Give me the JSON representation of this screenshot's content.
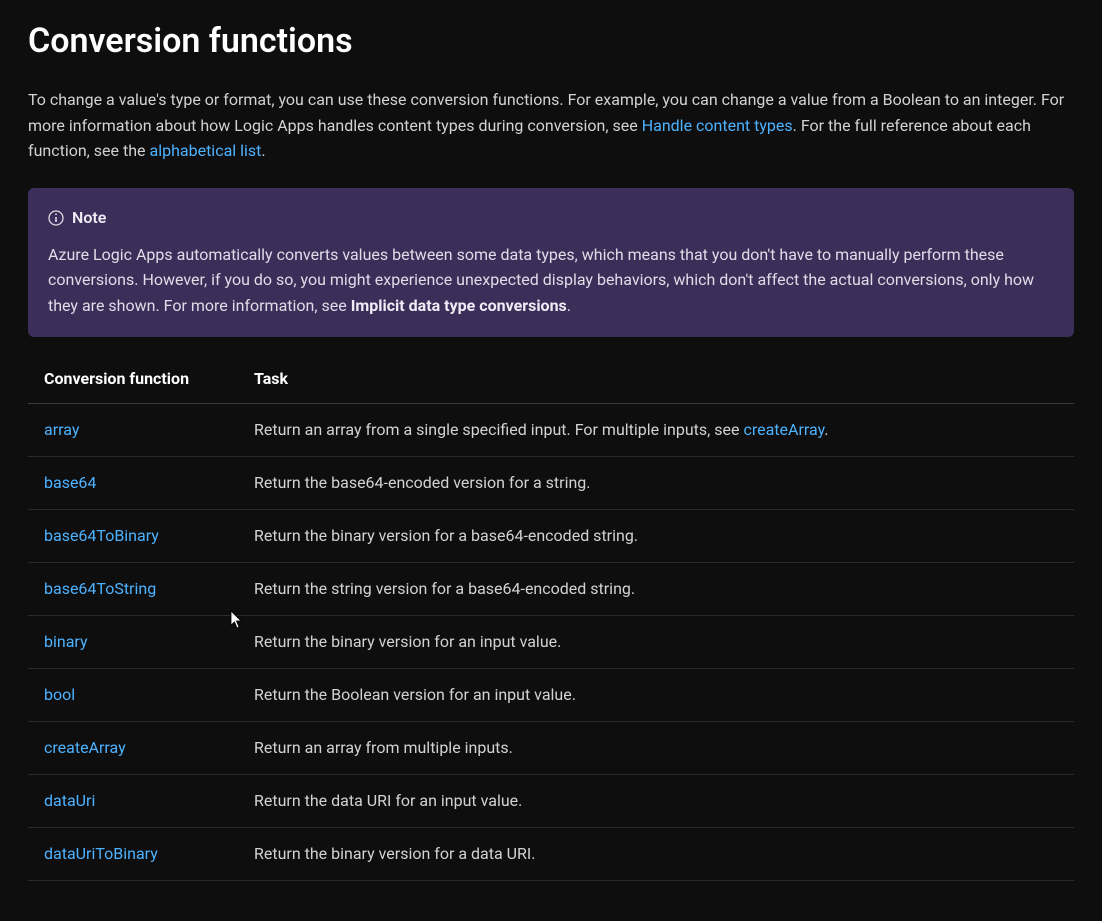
{
  "heading": "Conversion functions",
  "intro": {
    "text_before_link1": "To change a value's type or format, you can use these conversion functions. For example, you can change a value from a Boolean to an integer. For more information about how Logic Apps handles content types during conversion, see ",
    "link1": "Handle content types",
    "text_after_link1": ". For the full reference about each function, see the ",
    "link2": "alphabetical list",
    "text_after_link2": "."
  },
  "note": {
    "title": "Note",
    "body_before_strong": "Azure Logic Apps automatically converts values between some data types, which means that you don't have to manually perform these conversions. However, if you do so, you might experience unexpected display behaviors, which don't affect the actual conversions, only how they are shown. For more information, see ",
    "strong": "Implicit data type conversions",
    "body_after_strong": "."
  },
  "table": {
    "headers": {
      "func": "Conversion function",
      "task": "Task"
    },
    "rows": [
      {
        "func": "array",
        "task_before": "Return an array from a single specified input. For multiple inputs, see ",
        "task_link": "createArray",
        "task_after": "."
      },
      {
        "func": "base64",
        "task_before": "Return the base64-encoded version for a string.",
        "task_link": "",
        "task_after": ""
      },
      {
        "func": "base64ToBinary",
        "task_before": "Return the binary version for a base64-encoded string.",
        "task_link": "",
        "task_after": ""
      },
      {
        "func": "base64ToString",
        "task_before": "Return the string version for a base64-encoded string.",
        "task_link": "",
        "task_after": ""
      },
      {
        "func": "binary",
        "task_before": "Return the binary version for an input value.",
        "task_link": "",
        "task_after": ""
      },
      {
        "func": "bool",
        "task_before": "Return the Boolean version for an input value.",
        "task_link": "",
        "task_after": ""
      },
      {
        "func": "createArray",
        "task_before": "Return an array from multiple inputs.",
        "task_link": "",
        "task_after": ""
      },
      {
        "func": "dataUri",
        "task_before": "Return the data URI for an input value.",
        "task_link": "",
        "task_after": ""
      },
      {
        "func": "dataUriToBinary",
        "task_before": "Return the binary version for a data URI.",
        "task_link": "",
        "task_after": ""
      }
    ]
  }
}
